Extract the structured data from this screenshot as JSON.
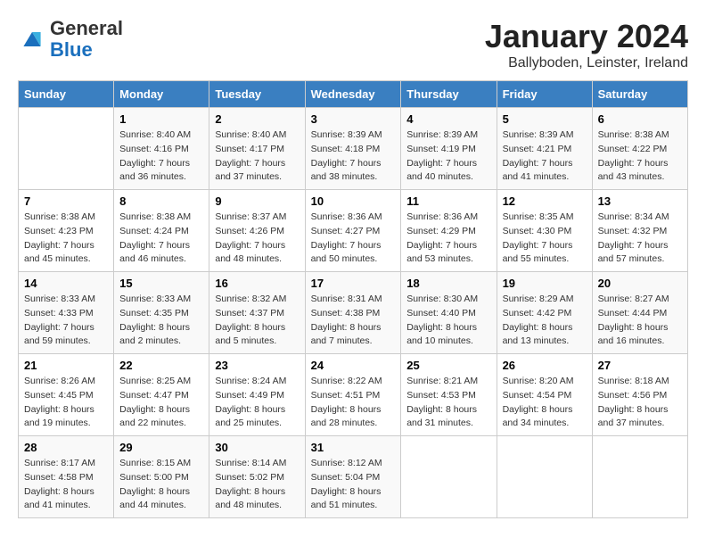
{
  "logo": {
    "general": "General",
    "blue": "Blue"
  },
  "header": {
    "month": "January 2024",
    "location": "Ballyboden, Leinster, Ireland"
  },
  "days_of_week": [
    "Sunday",
    "Monday",
    "Tuesday",
    "Wednesday",
    "Thursday",
    "Friday",
    "Saturday"
  ],
  "weeks": [
    [
      {
        "day": "",
        "sunrise": "",
        "sunset": "",
        "daylight": ""
      },
      {
        "day": "1",
        "sunrise": "Sunrise: 8:40 AM",
        "sunset": "Sunset: 4:16 PM",
        "daylight": "Daylight: 7 hours and 36 minutes."
      },
      {
        "day": "2",
        "sunrise": "Sunrise: 8:40 AM",
        "sunset": "Sunset: 4:17 PM",
        "daylight": "Daylight: 7 hours and 37 minutes."
      },
      {
        "day": "3",
        "sunrise": "Sunrise: 8:39 AM",
        "sunset": "Sunset: 4:18 PM",
        "daylight": "Daylight: 7 hours and 38 minutes."
      },
      {
        "day": "4",
        "sunrise": "Sunrise: 8:39 AM",
        "sunset": "Sunset: 4:19 PM",
        "daylight": "Daylight: 7 hours and 40 minutes."
      },
      {
        "day": "5",
        "sunrise": "Sunrise: 8:39 AM",
        "sunset": "Sunset: 4:21 PM",
        "daylight": "Daylight: 7 hours and 41 minutes."
      },
      {
        "day": "6",
        "sunrise": "Sunrise: 8:38 AM",
        "sunset": "Sunset: 4:22 PM",
        "daylight": "Daylight: 7 hours and 43 minutes."
      }
    ],
    [
      {
        "day": "7",
        "sunrise": "Sunrise: 8:38 AM",
        "sunset": "Sunset: 4:23 PM",
        "daylight": "Daylight: 7 hours and 45 minutes."
      },
      {
        "day": "8",
        "sunrise": "Sunrise: 8:38 AM",
        "sunset": "Sunset: 4:24 PM",
        "daylight": "Daylight: 7 hours and 46 minutes."
      },
      {
        "day": "9",
        "sunrise": "Sunrise: 8:37 AM",
        "sunset": "Sunset: 4:26 PM",
        "daylight": "Daylight: 7 hours and 48 minutes."
      },
      {
        "day": "10",
        "sunrise": "Sunrise: 8:36 AM",
        "sunset": "Sunset: 4:27 PM",
        "daylight": "Daylight: 7 hours and 50 minutes."
      },
      {
        "day": "11",
        "sunrise": "Sunrise: 8:36 AM",
        "sunset": "Sunset: 4:29 PM",
        "daylight": "Daylight: 7 hours and 53 minutes."
      },
      {
        "day": "12",
        "sunrise": "Sunrise: 8:35 AM",
        "sunset": "Sunset: 4:30 PM",
        "daylight": "Daylight: 7 hours and 55 minutes."
      },
      {
        "day": "13",
        "sunrise": "Sunrise: 8:34 AM",
        "sunset": "Sunset: 4:32 PM",
        "daylight": "Daylight: 7 hours and 57 minutes."
      }
    ],
    [
      {
        "day": "14",
        "sunrise": "Sunrise: 8:33 AM",
        "sunset": "Sunset: 4:33 PM",
        "daylight": "Daylight: 7 hours and 59 minutes."
      },
      {
        "day": "15",
        "sunrise": "Sunrise: 8:33 AM",
        "sunset": "Sunset: 4:35 PM",
        "daylight": "Daylight: 8 hours and 2 minutes."
      },
      {
        "day": "16",
        "sunrise": "Sunrise: 8:32 AM",
        "sunset": "Sunset: 4:37 PM",
        "daylight": "Daylight: 8 hours and 5 minutes."
      },
      {
        "day": "17",
        "sunrise": "Sunrise: 8:31 AM",
        "sunset": "Sunset: 4:38 PM",
        "daylight": "Daylight: 8 hours and 7 minutes."
      },
      {
        "day": "18",
        "sunrise": "Sunrise: 8:30 AM",
        "sunset": "Sunset: 4:40 PM",
        "daylight": "Daylight: 8 hours and 10 minutes."
      },
      {
        "day": "19",
        "sunrise": "Sunrise: 8:29 AM",
        "sunset": "Sunset: 4:42 PM",
        "daylight": "Daylight: 8 hours and 13 minutes."
      },
      {
        "day": "20",
        "sunrise": "Sunrise: 8:27 AM",
        "sunset": "Sunset: 4:44 PM",
        "daylight": "Daylight: 8 hours and 16 minutes."
      }
    ],
    [
      {
        "day": "21",
        "sunrise": "Sunrise: 8:26 AM",
        "sunset": "Sunset: 4:45 PM",
        "daylight": "Daylight: 8 hours and 19 minutes."
      },
      {
        "day": "22",
        "sunrise": "Sunrise: 8:25 AM",
        "sunset": "Sunset: 4:47 PM",
        "daylight": "Daylight: 8 hours and 22 minutes."
      },
      {
        "day": "23",
        "sunrise": "Sunrise: 8:24 AM",
        "sunset": "Sunset: 4:49 PM",
        "daylight": "Daylight: 8 hours and 25 minutes."
      },
      {
        "day": "24",
        "sunrise": "Sunrise: 8:22 AM",
        "sunset": "Sunset: 4:51 PM",
        "daylight": "Daylight: 8 hours and 28 minutes."
      },
      {
        "day": "25",
        "sunrise": "Sunrise: 8:21 AM",
        "sunset": "Sunset: 4:53 PM",
        "daylight": "Daylight: 8 hours and 31 minutes."
      },
      {
        "day": "26",
        "sunrise": "Sunrise: 8:20 AM",
        "sunset": "Sunset: 4:54 PM",
        "daylight": "Daylight: 8 hours and 34 minutes."
      },
      {
        "day": "27",
        "sunrise": "Sunrise: 8:18 AM",
        "sunset": "Sunset: 4:56 PM",
        "daylight": "Daylight: 8 hours and 37 minutes."
      }
    ],
    [
      {
        "day": "28",
        "sunrise": "Sunrise: 8:17 AM",
        "sunset": "Sunset: 4:58 PM",
        "daylight": "Daylight: 8 hours and 41 minutes."
      },
      {
        "day": "29",
        "sunrise": "Sunrise: 8:15 AM",
        "sunset": "Sunset: 5:00 PM",
        "daylight": "Daylight: 8 hours and 44 minutes."
      },
      {
        "day": "30",
        "sunrise": "Sunrise: 8:14 AM",
        "sunset": "Sunset: 5:02 PM",
        "daylight": "Daylight: 8 hours and 48 minutes."
      },
      {
        "day": "31",
        "sunrise": "Sunrise: 8:12 AM",
        "sunset": "Sunset: 5:04 PM",
        "daylight": "Daylight: 8 hours and 51 minutes."
      },
      {
        "day": "",
        "sunrise": "",
        "sunset": "",
        "daylight": ""
      },
      {
        "day": "",
        "sunrise": "",
        "sunset": "",
        "daylight": ""
      },
      {
        "day": "",
        "sunrise": "",
        "sunset": "",
        "daylight": ""
      }
    ]
  ]
}
